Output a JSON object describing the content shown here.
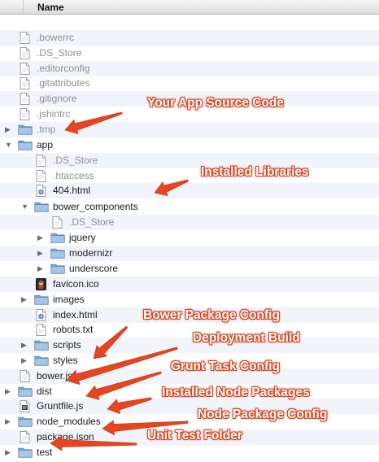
{
  "header": {
    "name_label": "Name"
  },
  "rows": [
    {
      "label": "",
      "type": "blank"
    },
    {
      "label": ".bowerrc",
      "type": "doc",
      "dim": true
    },
    {
      "label": ".DS_Store",
      "type": "doc",
      "dim": true
    },
    {
      "label": ".editorconfig",
      "type": "doc",
      "dim": true
    },
    {
      "label": ".gitattributes",
      "type": "doc",
      "dim": true
    },
    {
      "label": ".gitignore",
      "type": "doc",
      "dim": true
    },
    {
      "label": ".jshintrc",
      "type": "doc",
      "dim": true
    },
    {
      "label": ".tmp",
      "type": "folder",
      "expanded": false,
      "dim": true
    },
    {
      "label": "app",
      "type": "folder",
      "expanded": true
    },
    {
      "label": ".DS_Store",
      "type": "doc",
      "dim": true
    },
    {
      "label": ".htaccess",
      "type": "doc",
      "dim": true
    },
    {
      "label": "404.html",
      "type": "html"
    },
    {
      "label": "bower_components",
      "type": "folder",
      "expanded": true
    },
    {
      "label": ".DS_Store",
      "type": "doc",
      "dim": true
    },
    {
      "label": "jquery",
      "type": "folder",
      "expanded": false
    },
    {
      "label": "modernizr",
      "type": "folder",
      "expanded": false
    },
    {
      "label": "underscore",
      "type": "folder",
      "expanded": false
    },
    {
      "label": "favicon.ico",
      "type": "ico"
    },
    {
      "label": "images",
      "type": "folder",
      "expanded": false
    },
    {
      "label": "index.html",
      "type": "html"
    },
    {
      "label": "robots.txt",
      "type": "doc"
    },
    {
      "label": "scripts",
      "type": "folder",
      "expanded": false
    },
    {
      "label": "styles",
      "type": "folder",
      "expanded": false
    },
    {
      "label": "bower.json",
      "type": "doc"
    },
    {
      "label": "dist",
      "type": "folder",
      "expanded": false
    },
    {
      "label": "Gruntfile.js",
      "type": "js"
    },
    {
      "label": "node_modules",
      "type": "folder",
      "expanded": false
    },
    {
      "label": "package.json",
      "type": "doc"
    },
    {
      "label": "test",
      "type": "folder",
      "expanded": false
    }
  ],
  "annotations": [
    "Your App Source Code",
    "Installed Libraries",
    "Bower Package Config",
    "Deployment Build",
    "Grunt Task Config",
    "Installed Node Packages",
    "Node Package Config",
    "Unit Test Folder"
  ],
  "colors": {
    "annotation": "#d9401a",
    "arrow": "#e8451f",
    "folder": "#8fb8de",
    "row_alt": "#f1f5fb"
  }
}
